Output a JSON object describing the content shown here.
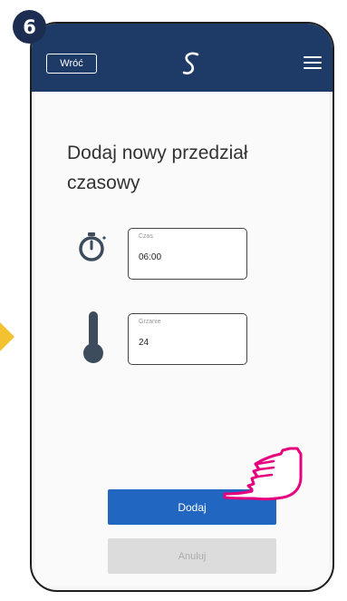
{
  "step": {
    "number": "6"
  },
  "header": {
    "back_label": "Wróć"
  },
  "page": {
    "title": "Dodaj nowy przedział czasowy"
  },
  "fields": {
    "time": {
      "label": "Czas",
      "value": "06:00"
    },
    "heating": {
      "label": "Grzanie",
      "value": "24"
    }
  },
  "actions": {
    "add_label": "Dodaj",
    "cancel_label": "Anuluj"
  },
  "colors": {
    "header_bg": "#1d3b66",
    "primary": "#2166c0",
    "step_badge": "#1d2d52",
    "hint_arrow": "#f2c231",
    "hand_outline": "#e5007e"
  },
  "icons": [
    "logo-icon",
    "menu-icon",
    "timer-icon",
    "thermometer-icon",
    "pointing-hand-icon"
  ]
}
